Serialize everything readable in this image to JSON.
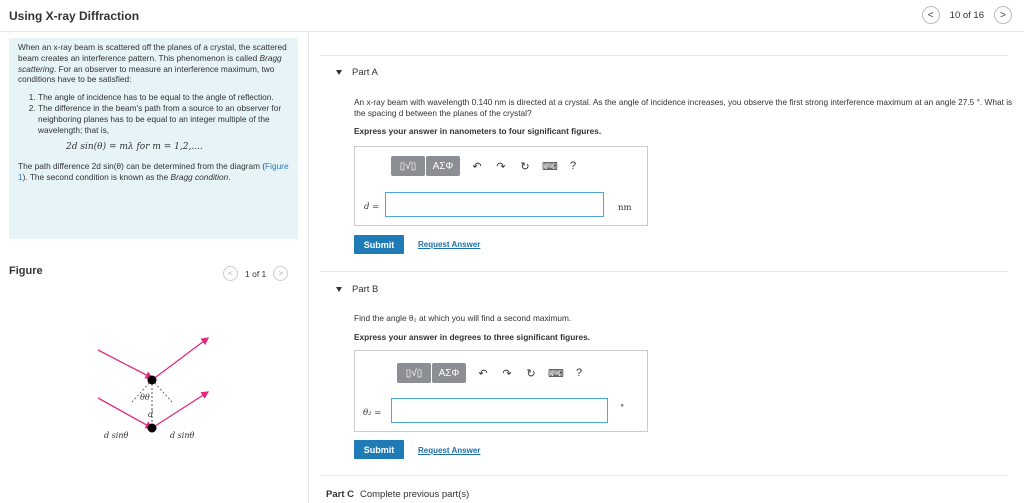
{
  "header": {
    "title": "Using X-ray Diffraction",
    "pager": "10 of 16",
    "prev_icon": "chevron-left-icon",
    "next_icon": "chevron-right-icon"
  },
  "intro": {
    "p1_a": "When an x-ray beam is scattered off the planes of a crystal, the scattered beam creates an interference pattern. This phenomenon is called ",
    "p1_em": "Bragg scattering",
    "p1_b": ". For an observer to measure an interference maximum, two conditions have to be satisfied:",
    "conditions": [
      "The angle of incidence has to be equal to the angle of reflection.",
      "The difference in the beam's path from a source to an observer for neighboring planes has to be equal to an integer multiple of the wavelength; that is,"
    ],
    "equation": "2d sin(θ) = mλ      for m = 1,2,....",
    "p2_a": "The path difference 2d sin(θ) can be determined from the diagram (",
    "p2_link": "Figure 1",
    "p2_b": "). The second condition is known as the ",
    "p2_em": "Bragg condition",
    "p2_c": "."
  },
  "figure": {
    "heading": "Figure",
    "pager": "1 of 1",
    "label_left": "d sinθ",
    "label_right": "d sinθ",
    "label_d": "d",
    "label_angles": "θθ"
  },
  "partA": {
    "title": "Part A",
    "question": "An x-ray beam with wavelength 0.140 nm is directed at a crystal. As the angle of incidence increases, you observe the first strong interference maximum at an angle 27.5 °. What is the spacing d between the planes of the crystal?",
    "instruction": "Express your answer in nanometers to four significant figures.",
    "var_label": "d =",
    "unit": "nm",
    "submit": "Submit",
    "request": "Request Answer"
  },
  "partB": {
    "title": "Part B",
    "question": "Find the angle θ₂ at which you will find a second maximum.",
    "instruction": "Express your answer in degrees to three significant figures.",
    "var_label": "θ₂ =",
    "unit": "°",
    "submit": "Submit",
    "request": "Request Answer"
  },
  "partC": {
    "label": "Part C",
    "status": "Complete previous part(s)"
  },
  "toolbar": {
    "templates": "▯√▯",
    "symbols": "ΑΣΦ",
    "undo": "↶",
    "redo": "↷",
    "reset": "↻",
    "keyboard": "⌨",
    "help": "?"
  }
}
